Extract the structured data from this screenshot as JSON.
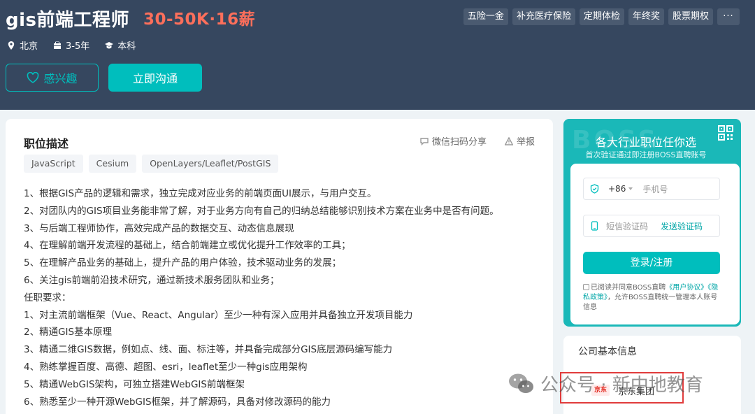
{
  "job": {
    "title": "gis前端工程师",
    "salary": "30-50K·16薪",
    "benefits": [
      "五险一金",
      "补充医疗保险",
      "定期体检",
      "年终奖",
      "股票期权",
      "···"
    ],
    "meta": {
      "city": "北京",
      "experience": "3-5年",
      "degree": "本科"
    },
    "buttons": {
      "interest": "感兴趣",
      "chat": "立即沟通"
    }
  },
  "description": {
    "title": "职位描述",
    "share_label": "微信扫码分享",
    "report_label": "举报",
    "tags": [
      "JavaScript",
      "Cesium",
      "OpenLayers/Leaflet/PostGIS"
    ],
    "lines": [
      "1、根据GIS产品的逻辑和需求，独立完成对应业务的前端页面UI展示，与用户交互。",
      "2、对团队内的GIS项目业务能非常了解，对于业务方向有自己的归纳总结能够识别技术方案在业务中是否有问题。",
      "3、与后端工程师协作，高效完成产品的数据交互、动态信息展现",
      "4、在理解前端开发流程的基础上，结合前端建立或优化提升工作效率的工具；",
      "5、在理解产品业务的基础上，提升产品的用户体验，技术驱动业务的发展；",
      "6、关注gis前端前沿技术研究，通过新技术服务团队和业务；",
      "任职要求：",
      "1、对主流前端框架（Vue、React、Angular）至少一种有深入应用并具备独立开发项目能力",
      "2、精通GIS基本原理",
      "3、精通二维GIS数据，例如点、线、面、标注等，并具备完成部分GIS底层源码编写能力",
      "4、熟练掌握百度、高德、超图、esri，leaflet至少一种gis应用架构",
      "5、精通WebGIS架构，可独立搭建WebGIS前端框架",
      "6、熟悉至少一种开源WebGIS框架，并了解源码，具备对修改源码的能力"
    ]
  },
  "promo": {
    "watermark": "BOSS",
    "title": "各大行业职位任你选",
    "subtitle": "首次验证通过即注册BOSS直聘账号",
    "country_code": "+86",
    "phone_placeholder": "手机号",
    "code_placeholder": "短信验证码",
    "send_code": "发送验证码",
    "login_button": "登录/注册",
    "agree_prefix": "已阅读并同意BOSS直聘",
    "user_agreement": "《用户协议》",
    "privacy_policy": "《隐私政策》",
    "agree_suffix": "，允许BOSS直聘统一管理本人账号信息"
  },
  "company": {
    "title": "公司基本信息",
    "logo_text": "京东",
    "name": "京东集团"
  },
  "watermark": {
    "text": "公众号 · 新中地教育"
  },
  "colors": {
    "header_bg": "#36475f",
    "accent": "#00bebd",
    "salary": "#fd6f5b",
    "highlight": "#e13c3c"
  }
}
